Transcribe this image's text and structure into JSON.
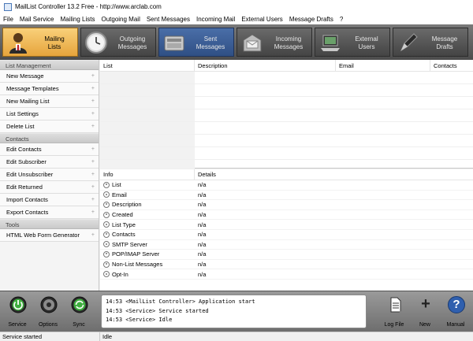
{
  "window": {
    "title": "MailList Controller 13.2 Free - http://www.arclab.com"
  },
  "menu": [
    "File",
    "Mail Service",
    "Mailing Lists",
    "Outgoing Mail",
    "Sent Messages",
    "Incoming Mail",
    "External Users",
    "Message Drafts",
    "?"
  ],
  "toolbar": {
    "mailing_lists": {
      "line1": "Mailing",
      "line2": "Lists",
      "icon": "person-icon"
    },
    "outgoing": {
      "line1": "Outgoing",
      "line2": "Messages",
      "icon": "clock-icon"
    },
    "sent": {
      "line1": "Sent",
      "line2": "Messages",
      "icon": "mailbox-icon"
    },
    "incoming": {
      "line1": "Incoming",
      "line2": "Messages",
      "icon": "inbox-icon"
    },
    "external": {
      "line1": "External",
      "line2": "Users",
      "icon": "laptop-icon"
    },
    "drafts": {
      "line1": "Message",
      "line2": "Drafts",
      "icon": "pen-icon"
    }
  },
  "sidebar": {
    "list_management": {
      "header": "List Management",
      "items": [
        "New Message",
        "Message Templates",
        "New Mailing List",
        "List Settings",
        "Delete List"
      ]
    },
    "contacts": {
      "header": "Contacts",
      "items": [
        "Edit Contacts",
        "Edit Subscriber",
        "Edit Unsubscriber",
        "Edit Returned",
        "Import Contacts",
        "Export Contacts"
      ]
    },
    "tools": {
      "header": "Tools",
      "items": [
        "HTML Web Form Generator"
      ]
    },
    "arrow": "+"
  },
  "list_table": {
    "columns": [
      "List",
      "Description",
      "Email",
      "Contacts"
    ]
  },
  "info_table": {
    "columns": [
      "Info",
      "Details"
    ],
    "rows": [
      {
        "k": "List",
        "v": "n/a"
      },
      {
        "k": "Email",
        "v": "n/a"
      },
      {
        "k": "Description",
        "v": "n/a"
      },
      {
        "k": "Created",
        "v": "n/a"
      },
      {
        "k": "List Type",
        "v": "n/a"
      },
      {
        "k": "Contacts",
        "v": "n/a"
      },
      {
        "k": "SMTP Server",
        "v": "n/a"
      },
      {
        "k": "POP/IMAP Server",
        "v": "n/a"
      },
      {
        "k": "Non-List Messages",
        "v": "n/a"
      },
      {
        "k": "Opt-In",
        "v": "n/a"
      }
    ]
  },
  "bottom": {
    "service": "Service",
    "options": "Options",
    "sync": "Sync",
    "log_file": "Log File",
    "new": "New",
    "manual": "Manual",
    "new_glyph": "+",
    "manual_glyph": "?",
    "log": [
      "14:53 <MailList Controller> Application start",
      "14:53 <Service> Service started",
      "14:53 <Service> Idle"
    ]
  },
  "status": {
    "left": "Service started",
    "right": "Idle"
  },
  "colors": {
    "accent": "#f0b04c",
    "toolbar_blue": "#3d5f96",
    "green": "#3fae3f"
  }
}
